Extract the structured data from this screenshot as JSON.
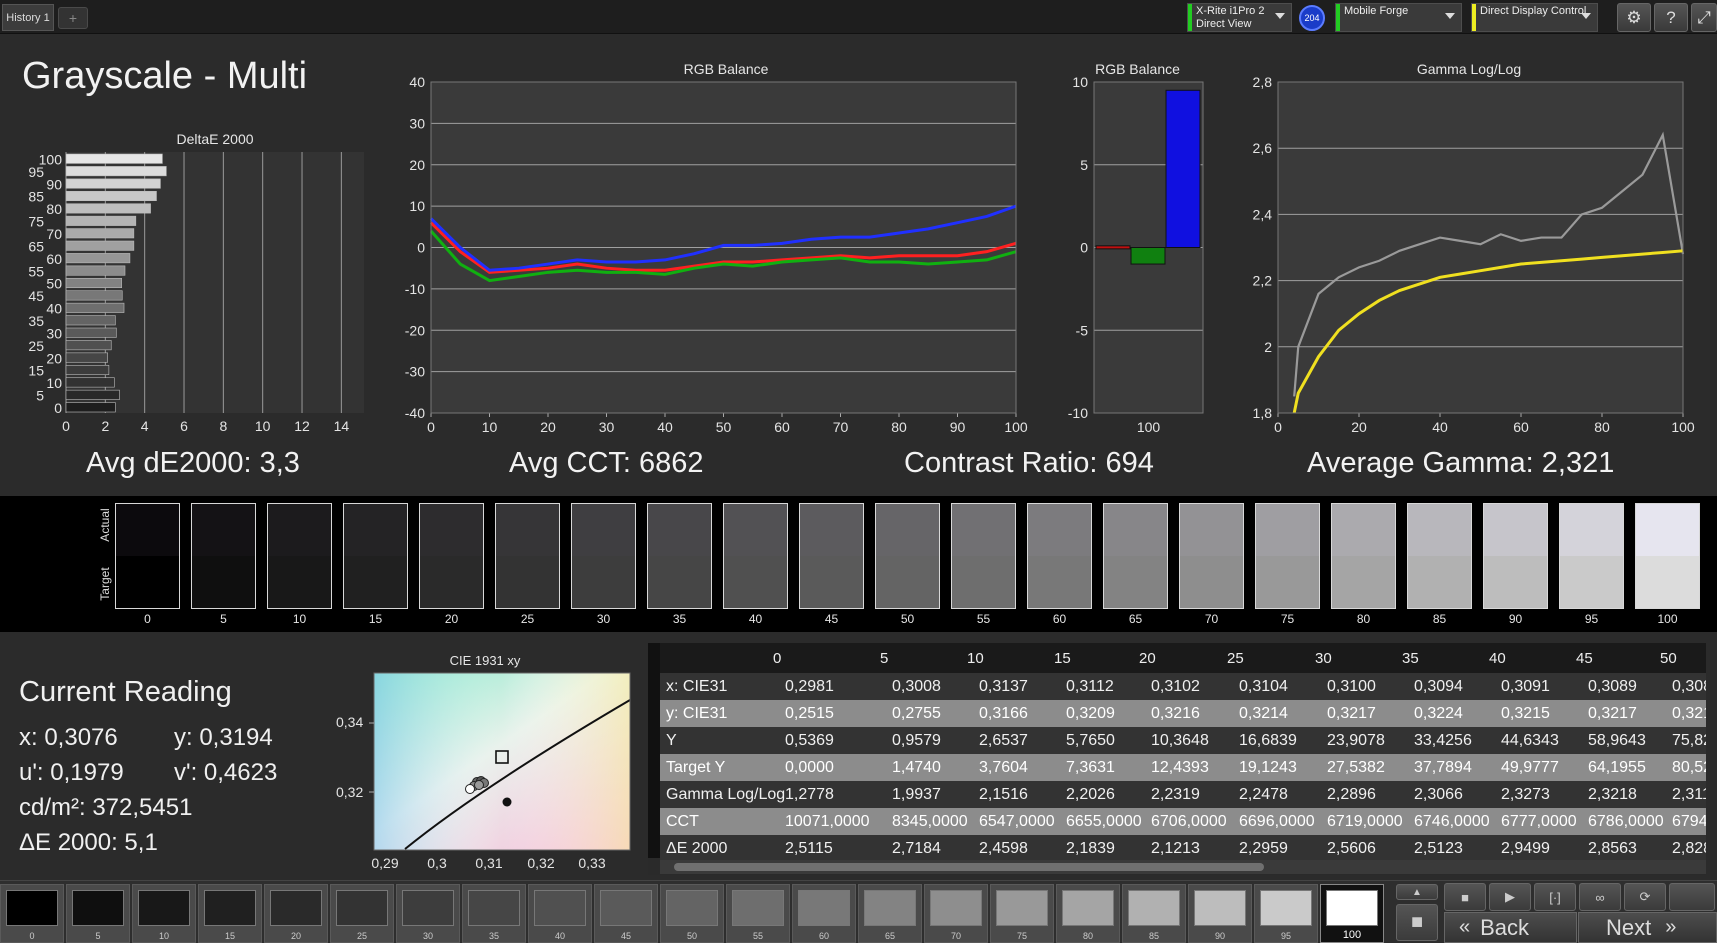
{
  "header": {
    "tab_label": "History 1",
    "tab_add": "+",
    "meter": {
      "line1": "X-Rite i1Pro 2",
      "line2": "Direct View",
      "stripe": "#22cc22"
    },
    "badge": "204",
    "generator": {
      "label": "Mobile Forge",
      "stripe": "#22cc22"
    },
    "display_control": {
      "label": "Direct Display Control",
      "stripe": "#eeee22"
    },
    "icons": {
      "settings": "⚙",
      "help": "?",
      "expand": "⤢"
    }
  },
  "page_title": "Grayscale - Multi",
  "stats": {
    "avg_de": "Avg dE2000: 3,3",
    "avg_cct": "Avg CCT: 6862",
    "contrast": "Contrast Ratio: 694",
    "avg_gamma": "Average Gamma: 2,321"
  },
  "chart_data": [
    {
      "type": "bar",
      "title": "DeltaE 2000",
      "orientation": "horizontal",
      "categories": [
        "0",
        "5",
        "10",
        "15",
        "20",
        "25",
        "30",
        "35",
        "40",
        "45",
        "50",
        "55",
        "60",
        "65",
        "70",
        "75",
        "80",
        "85",
        "90",
        "95",
        "100"
      ],
      "values": [
        2.51,
        2.72,
        2.46,
        2.18,
        2.12,
        2.3,
        2.56,
        2.51,
        2.95,
        2.86,
        2.83,
        3.0,
        3.25,
        3.45,
        3.45,
        3.55,
        4.3,
        4.6,
        4.8,
        5.1,
        4.9
      ],
      "y_tick_labels": [
        "0",
        "5",
        "10",
        "15",
        "20",
        "25",
        "30",
        "35",
        "40",
        "45",
        "50",
        "55",
        "60",
        "65",
        "70",
        "75",
        "80",
        "85",
        "90",
        "95",
        "100"
      ],
      "x_ticks": [
        "0",
        "2",
        "4",
        "6",
        "8",
        "10",
        "12",
        "14"
      ],
      "xlim": [
        0,
        15
      ]
    },
    {
      "type": "line",
      "title": "RGB Balance",
      "x": [
        0,
        5,
        10,
        15,
        20,
        25,
        30,
        35,
        40,
        45,
        50,
        55,
        60,
        65,
        70,
        75,
        80,
        85,
        90,
        95,
        100
      ],
      "series": [
        {
          "color": "#ff2020",
          "values": [
            6,
            -1,
            -6,
            -5.5,
            -5,
            -4,
            -5,
            -5.5,
            -5.5,
            -4.5,
            -3.5,
            -3.5,
            -3,
            -2.5,
            -2,
            -2.5,
            -2,
            -2,
            -2,
            -1,
            1
          ]
        },
        {
          "color": "#10b010",
          "values": [
            4,
            -4,
            -8,
            -7,
            -6,
            -5.5,
            -6,
            -6,
            -6.5,
            -5,
            -4,
            -4.5,
            -3.5,
            -3,
            -2.5,
            -3.5,
            -3.5,
            -4,
            -3.5,
            -3,
            -1
          ]
        },
        {
          "color": "#2030ff",
          "values": [
            7,
            0,
            -5.5,
            -5,
            -4,
            -3,
            -3.5,
            -3.5,
            -3,
            -1.5,
            0.5,
            0.5,
            1,
            2,
            2.5,
            2.5,
            3.5,
            4.5,
            6,
            7.5,
            10
          ]
        }
      ],
      "x_ticks": [
        "0",
        "10",
        "20",
        "30",
        "40",
        "50",
        "60",
        "70",
        "80",
        "90",
        "100"
      ],
      "y_ticks": [
        "40",
        "30",
        "20",
        "10",
        "0",
        "-10",
        "-20",
        "-30",
        "-40"
      ],
      "ylim": [
        -40,
        40
      ]
    },
    {
      "type": "bar",
      "title": "RGB Balance",
      "categories": [
        "100"
      ],
      "series": [
        {
          "color": "#c01010",
          "values": [
            0.1
          ]
        },
        {
          "color": "#108010",
          "values": [
            -1.0
          ]
        },
        {
          "color": "#1010e0",
          "values": [
            9.5
          ]
        }
      ],
      "y_ticks": [
        "10",
        "5",
        "0",
        "-5",
        "-10"
      ],
      "ylim": [
        -10,
        10
      ]
    },
    {
      "type": "line",
      "title": "Gamma Log/Log",
      "x": [
        4,
        5,
        10,
        15,
        20,
        25,
        30,
        35,
        40,
        45,
        50,
        55,
        60,
        65,
        70,
        75,
        80,
        85,
        90,
        95,
        100
      ],
      "series": [
        {
          "color": "#9a9a9a",
          "values": [
            1.85,
            2.0,
            2.16,
            2.21,
            2.24,
            2.26,
            2.29,
            2.31,
            2.33,
            2.32,
            2.31,
            2.34,
            2.32,
            2.33,
            2.33,
            2.4,
            2.42,
            2.47,
            2.52,
            2.64,
            2.28
          ]
        },
        {
          "color": "#f0e020",
          "values": [
            1.8,
            1.86,
            1.97,
            2.05,
            2.1,
            2.14,
            2.17,
            2.19,
            2.21,
            2.22,
            2.23,
            2.24,
            2.25,
            2.255,
            2.26,
            2.265,
            2.27,
            2.275,
            2.28,
            2.285,
            2.29
          ]
        }
      ],
      "x_ticks": [
        "0",
        "20",
        "40",
        "60",
        "80",
        "100"
      ],
      "y_ticks": [
        "2,8",
        "2,6",
        "2,4",
        "2,2",
        "2",
        "1,8"
      ],
      "ylim": [
        1.8,
        2.8
      ]
    }
  ],
  "swatches": {
    "actual_label": "Actual",
    "target_label": "Target",
    "items": [
      {
        "label": "0",
        "actual": "#0c0a0d",
        "target": "#000000"
      },
      {
        "label": "5",
        "actual": "#141215",
        "target": "#0f0f0f"
      },
      {
        "label": "10",
        "actual": "#1c1b1d",
        "target": "#181818"
      },
      {
        "label": "15",
        "actual": "#242325",
        "target": "#202020"
      },
      {
        "label": "20",
        "actual": "#2d2c2e",
        "target": "#2a2a2a"
      },
      {
        "label": "25",
        "actual": "#363537",
        "target": "#333333"
      },
      {
        "label": "30",
        "actual": "#3f3e41",
        "target": "#3d3d3d"
      },
      {
        "label": "35",
        "actual": "#48474a",
        "target": "#464646"
      },
      {
        "label": "40",
        "actual": "#525154",
        "target": "#505050"
      },
      {
        "label": "45",
        "actual": "#5c5b5e",
        "target": "#5a5a5a"
      },
      {
        "label": "50",
        "actual": "#666568",
        "target": "#646464"
      },
      {
        "label": "55",
        "actual": "#717073",
        "target": "#6e6e6e"
      },
      {
        "label": "60",
        "actual": "#7c7b7e",
        "target": "#787878"
      },
      {
        "label": "65",
        "actual": "#878689",
        "target": "#838383"
      },
      {
        "label": "70",
        "actual": "#939295",
        "target": "#8e8e8e"
      },
      {
        "label": "75",
        "actual": "#9f9ea2",
        "target": "#999999"
      },
      {
        "label": "80",
        "actual": "#abaaae",
        "target": "#a5a5a5"
      },
      {
        "label": "85",
        "actual": "#b8b7bc",
        "target": "#b1b1b1"
      },
      {
        "label": "90",
        "actual": "#c6c5cb",
        "target": "#bdbdbd"
      },
      {
        "label": "95",
        "actual": "#d4d3da",
        "target": "#cacaca"
      },
      {
        "label": "100",
        "actual": "#e6e5ef",
        "target": "#dcdcdc"
      }
    ]
  },
  "current_reading": {
    "title": "Current Reading",
    "x": "x: 0,3076",
    "y": "y: 0,3194",
    "u": "u': 0,1979",
    "v": "v': 0,4623",
    "cdm2": "cd/m²: 372,5451",
    "de": "ΔE 2000: 5,1"
  },
  "cie_chart": {
    "title": "CIE 1931 xy",
    "x_ticks": [
      "0,29",
      "0,3",
      "0,31",
      "0,32",
      "0,33"
    ],
    "y_ticks": [
      "0,34",
      "0,32"
    ]
  },
  "table": {
    "columns": [
      "0",
      "5",
      "10",
      "15",
      "20",
      "25",
      "30",
      "35",
      "40",
      "45",
      "50"
    ],
    "rows": [
      {
        "label": "x: CIE31",
        "values": [
          "0,2981",
          "0,3008",
          "0,3137",
          "0,3112",
          "0,3102",
          "0,3104",
          "0,3100",
          "0,3094",
          "0,3091",
          "0,3089",
          "0,308"
        ]
      },
      {
        "label": "y: CIE31",
        "values": [
          "0,2515",
          "0,2755",
          "0,3166",
          "0,3209",
          "0,3216",
          "0,3214",
          "0,3217",
          "0,3224",
          "0,3215",
          "0,3217",
          "0,321"
        ]
      },
      {
        "label": "Y",
        "values": [
          "0,5369",
          "0,9579",
          "2,6537",
          "5,7650",
          "10,3648",
          "16,6839",
          "23,9078",
          "33,4256",
          "44,6343",
          "58,9643",
          "75,82"
        ]
      },
      {
        "label": "Target Y",
        "values": [
          "0,0000",
          "1,4740",
          "3,7604",
          "7,3631",
          "12,4393",
          "19,1243",
          "27,5382",
          "37,7894",
          "49,9777",
          "64,1955",
          "80,52"
        ]
      },
      {
        "label": "Gamma Log/Log",
        "values": [
          "1,2778",
          "1,9937",
          "2,1516",
          "2,2026",
          "2,2319",
          "2,2478",
          "2,2896",
          "2,3066",
          "2,3273",
          "2,3218",
          "2,311"
        ]
      },
      {
        "label": "CCT",
        "values": [
          "10071,0000",
          "8345,0000",
          "6547,0000",
          "6655,0000",
          "6706,0000",
          "6696,0000",
          "6719,0000",
          "6746,0000",
          "6777,0000",
          "6786,0000",
          "6794,"
        ]
      },
      {
        "label": "ΔE 2000",
        "values": [
          "2,5115",
          "2,7184",
          "2,4598",
          "2,1839",
          "2,1213",
          "2,2959",
          "2,5606",
          "2,5123",
          "2,9499",
          "2,8563",
          "2,828"
        ]
      }
    ]
  },
  "palette": {
    "items": [
      {
        "label": "0",
        "color": "#000000"
      },
      {
        "label": "5",
        "color": "#0f0f0f"
      },
      {
        "label": "10",
        "color": "#181818"
      },
      {
        "label": "15",
        "color": "#202020"
      },
      {
        "label": "20",
        "color": "#2a2a2a"
      },
      {
        "label": "25",
        "color": "#333333"
      },
      {
        "label": "30",
        "color": "#3d3d3d"
      },
      {
        "label": "35",
        "color": "#464646"
      },
      {
        "label": "40",
        "color": "#505050"
      },
      {
        "label": "45",
        "color": "#5a5a5a"
      },
      {
        "label": "50",
        "color": "#646464"
      },
      {
        "label": "55",
        "color": "#6e6e6e"
      },
      {
        "label": "60",
        "color": "#787878"
      },
      {
        "label": "65",
        "color": "#838383"
      },
      {
        "label": "70",
        "color": "#8e8e8e"
      },
      {
        "label": "75",
        "color": "#999999"
      },
      {
        "label": "80",
        "color": "#a5a5a5"
      },
      {
        "label": "85",
        "color": "#b1b1b1"
      },
      {
        "label": "90",
        "color": "#bdbdbd"
      },
      {
        "label": "95",
        "color": "#cacaca"
      },
      {
        "label": "100",
        "color": "#ffffff"
      }
    ],
    "selected": "100"
  },
  "controls": {
    "stop": "■",
    "play": "▶",
    "loop": "∞",
    "refresh": "⟳",
    "bracket": "[·]",
    "up": "▲",
    "record": "■",
    "back_label": "Back",
    "next_label": "Next",
    "back_icon": "«",
    "next_icon": "»"
  }
}
